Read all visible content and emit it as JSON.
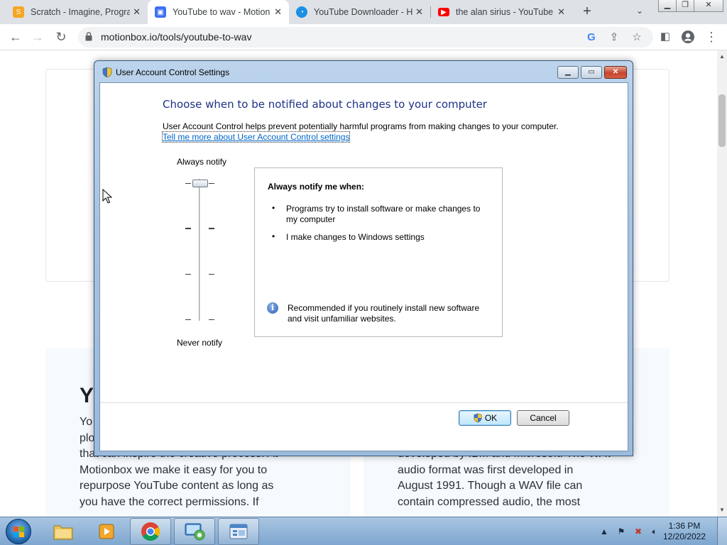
{
  "browser": {
    "tabs": [
      {
        "title": "Scratch - Imagine, Progra",
        "favicon": "scratch-icon",
        "color": "#f5a623"
      },
      {
        "title": "YouTube to wav - Motion",
        "favicon": "motionbox-icon",
        "color": "#3f6ff2"
      },
      {
        "title": "YouTube Downloader - H",
        "favicon": "downloader-icon",
        "color": "#1a8fe3"
      },
      {
        "title": "the alan sirius - YouTube",
        "favicon": "youtube-icon",
        "color": "#ff0000"
      }
    ],
    "active_tab": 1,
    "url": "motionbox.io/tools/youtube-to-wav"
  },
  "page": {
    "heading": "Y",
    "left_lines": [
      "Yo",
      "plo",
      "that can inspire the creative process. At",
      "Motionbox we make it easy for you to",
      "repurpose YouTube content as long as",
      "you have the correct permissions. If"
    ],
    "right_lines": [
      "developed by IBM and Microsoft. The WAV",
      "audio format was first developed in",
      "August 1991. Though a WAV file can",
      "contain compressed audio, the most"
    ]
  },
  "dialog": {
    "title": "User Account Control Settings",
    "heading": "Choose when to be notified about changes to your computer",
    "description": "User Account Control helps prevent potentially harmful programs from making changes to your computer.",
    "link": "Tell me more about User Account Control settings",
    "slider": {
      "top_label": "Always notify",
      "bottom_label": "Never notify",
      "level": 4,
      "levels": 4
    },
    "info": {
      "heading": "Always notify me when:",
      "bullets": [
        "Programs try to install software or make changes to my computer",
        "I make changes to Windows settings"
      ],
      "note": "Recommended if you routinely install new software and visit unfamiliar websites."
    },
    "ok_label": "OK",
    "cancel_label": "Cancel"
  },
  "taskbar": {
    "time": "1:36 PM",
    "date": "12/20/2022"
  }
}
